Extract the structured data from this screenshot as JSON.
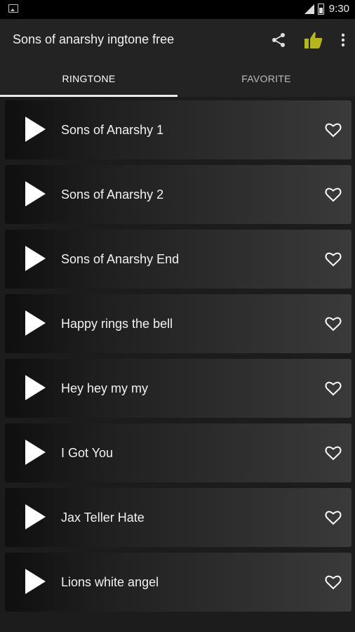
{
  "status_bar": {
    "time": "9:30"
  },
  "app_bar": {
    "title": "Sons of anarshy ingtone free"
  },
  "tabs": [
    {
      "label": "RINGTONE"
    },
    {
      "label": "FAVORITE"
    }
  ],
  "ringtones": [
    {
      "title": "Sons of Anarshy 1"
    },
    {
      "title": "Sons of Anarshy 2"
    },
    {
      "title": "Sons of Anarshy End"
    },
    {
      "title": "Happy rings the bell"
    },
    {
      "title": "Hey hey my my"
    },
    {
      "title": "I Got You"
    },
    {
      "title": "Jax Teller Hate"
    },
    {
      "title": "Lions white angel"
    }
  ],
  "colors": {
    "accent_like": "#b5b51c",
    "background": "#1c1c1c",
    "bar": "#232323"
  },
  "icons": [
    "image-icon",
    "signal-icon",
    "battery-icon",
    "share-icon",
    "thumbs-up-icon",
    "more-vert-icon",
    "play-icon",
    "heart-outline-icon"
  ]
}
